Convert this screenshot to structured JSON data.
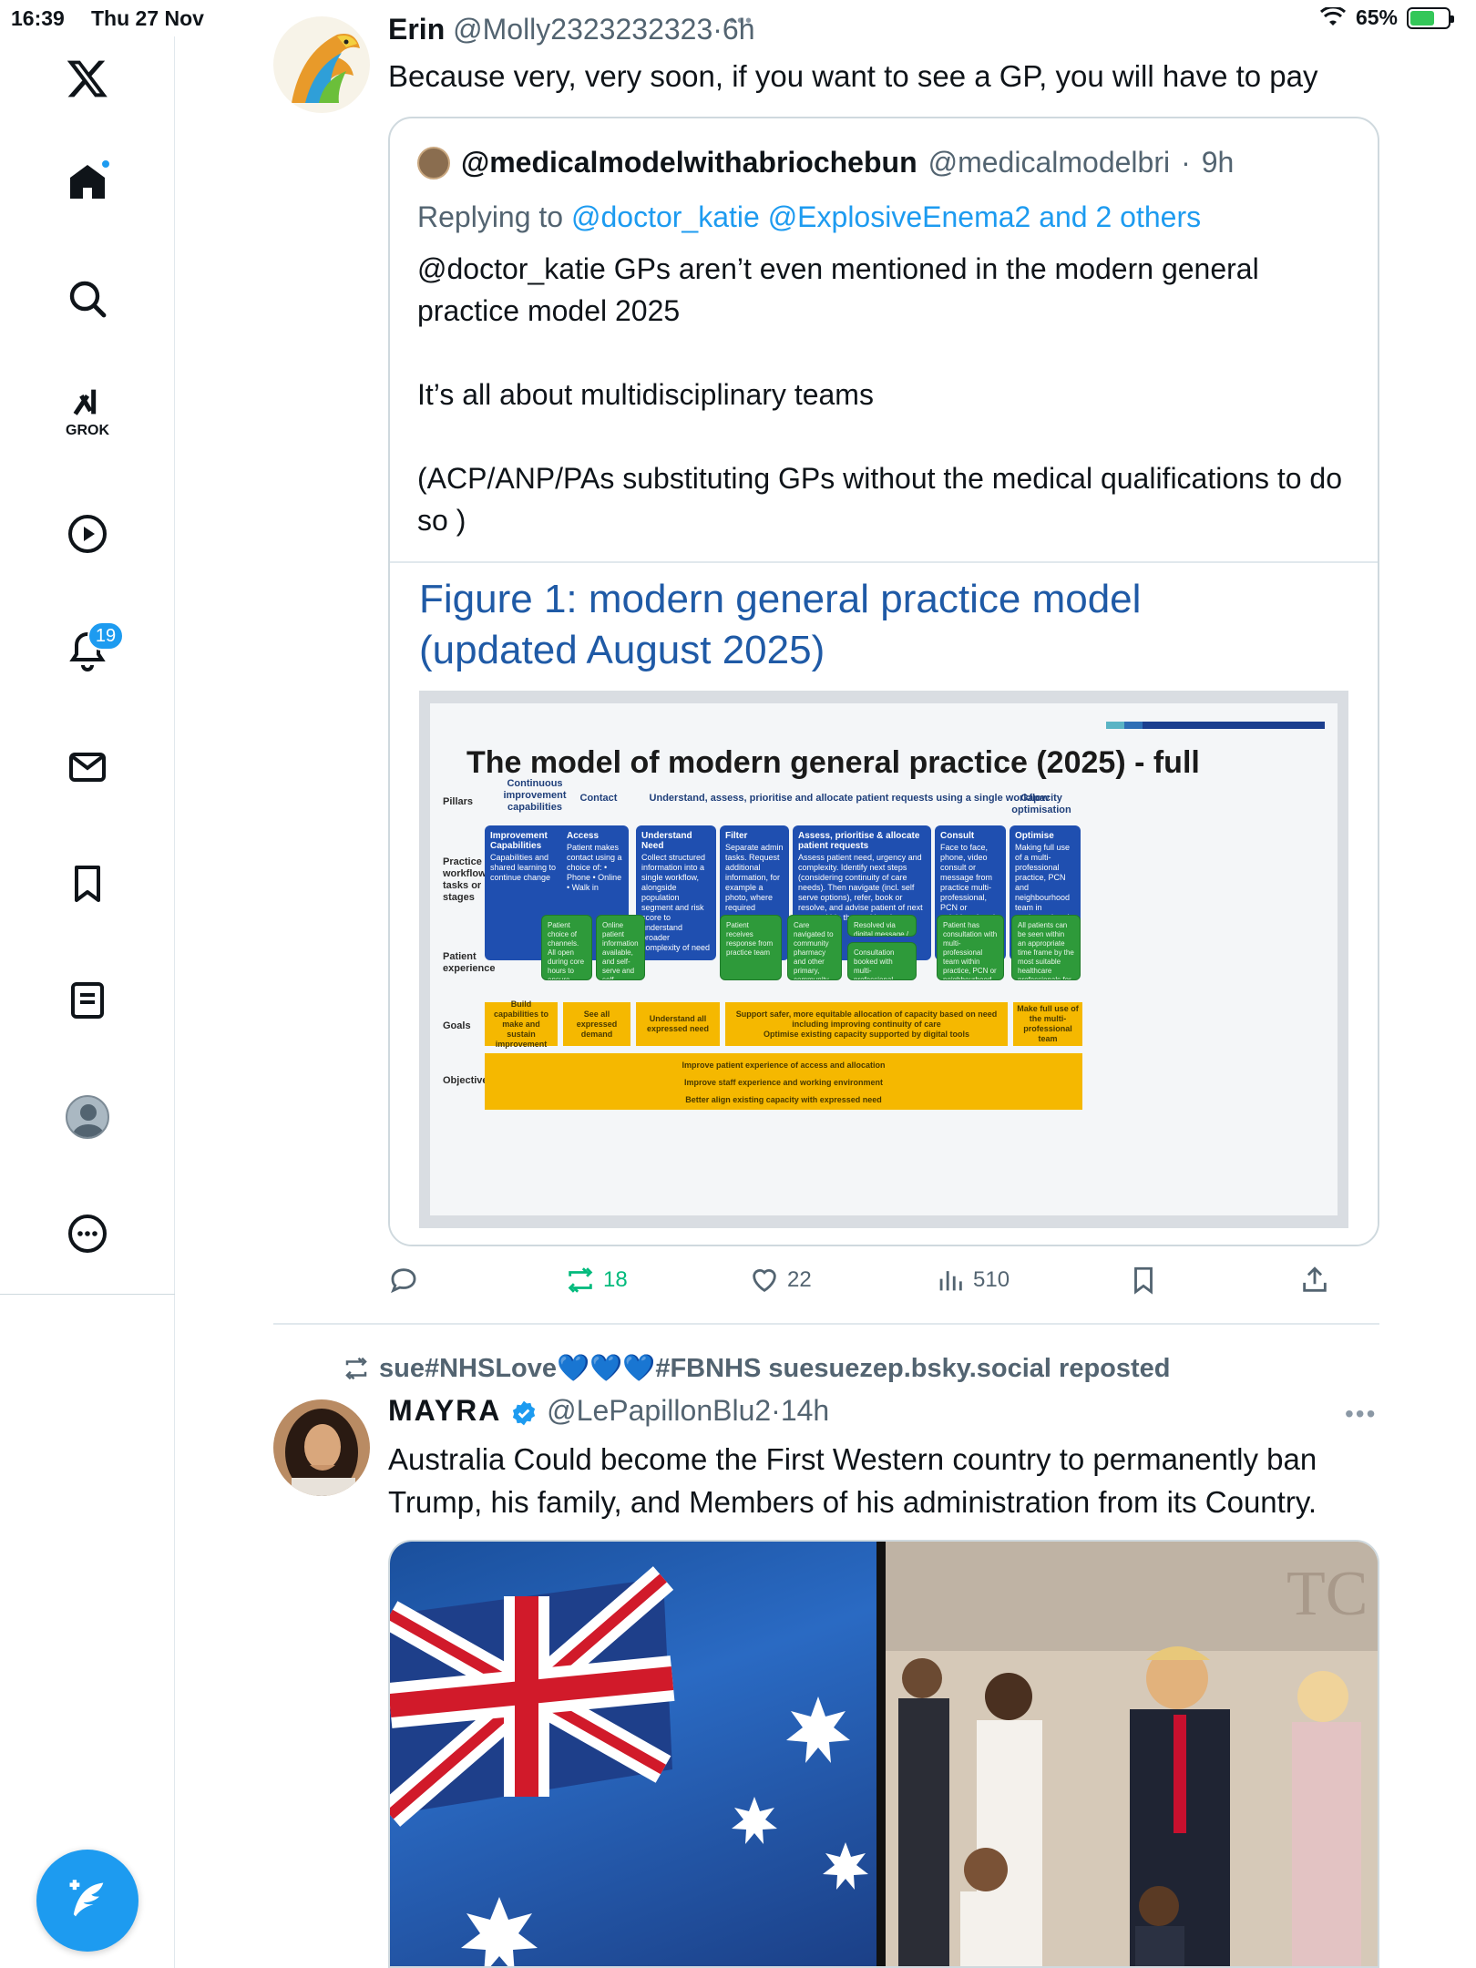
{
  "status_bar": {
    "time": "16:39",
    "date": "Thu 27 Nov",
    "battery": "65%",
    "battery_level": 0.65
  },
  "sidebar": {
    "grok_label": "GROK",
    "notifications_count": "19",
    "items": [
      "home",
      "explore",
      "grok",
      "video",
      "notifications",
      "messages",
      "bookmarks",
      "lists",
      "profile",
      "more"
    ]
  },
  "tweet1": {
    "name": "Erin",
    "handle": "@Molly2323232323",
    "time": "6h",
    "text": "Because very, very soon,  if you want to see a GP, you will have to pay",
    "quote": {
      "name": "@medicalmodelwithabriochebun",
      "handle": "@medicalmodelbri",
      "time": "9h",
      "replying_prefix": "Replying to",
      "replying_to": "@doctor_katie @ExplosiveEnema2 and 2 others",
      "body": "@doctor_katie GPs aren’t even mentioned in the modern general practice model 2025\n\nIt’s all about multidisciplinary teams\n\n(ACP/ANP/PAs substituting GPs without the medical qualifications to do so )",
      "figure": {
        "title": "Figure 1: modern general practice model\n(updated August 2025)",
        "main_title": "The model of modern general practice (2025) - full",
        "row_labels": {
          "pillars": "Pillars",
          "workflow": "Practice workflow tasks or stages",
          "experience": "Patient experience",
          "goals": "Goals",
          "objectives": "Objectives"
        },
        "col_headers": {
          "ci": "Continuous improvement capabilities",
          "contact": "Contact",
          "understand": "Understand, assess, prioritise and allocate patient requests using a single workflow",
          "capacity": "Capacity optimisation"
        },
        "blue_boxes": [
          {
            "title": "Improvement Capabilities",
            "text": "Capabilities and shared learning to continue change"
          },
          {
            "title": "Access",
            "text": "Patient makes contact using a choice of: • Phone • Online • Walk in"
          },
          {
            "title": "Understand Need",
            "text": "Collect structured information into a single workflow, alongside population segment and risk score to understand broader complexity of need"
          },
          {
            "title": "Filter",
            "text": "Separate admin tasks. Request additional information, for example a photo, where required"
          },
          {
            "title": "Assess, prioritise & allocate patient requests",
            "text": "Assess patient need, urgency and complexity. Identify next steps (considering continuity of care needs). Then navigate (incl. self serve options), refer, book or resolve, and advise patient of next steps within the working day."
          },
          {
            "title": "Consult",
            "text": "Face to face, phone, video consult or message from practice multi-professional, PCN or neighbourhood team"
          },
          {
            "title": "Optimise",
            "text": "Making full use of a multi-professional practice, PCN and neighbourhood team in unplanned and planned care"
          }
        ],
        "green_boxes": [
          "Patient choice of channels. All open during core hours to ensure parity",
          "Online patient information available, and self-serve and self-referral",
          "Patient receives response from practice team",
          "Care navigated to community pharmacy and other primary, community and VCSE services",
          "Resolved via digital message / phone",
          "Consultation booked with multi-professional team using self booking link where appropriate",
          "Patient has consultation with multi-professional team within practice, PCN or neighbourhood team",
          "All patients can be seen within an appropriate time frame by the most suitable healthcare professionals for their needs"
        ],
        "goals": [
          "Build capabilities to make and sustain improvement",
          "See all expressed demand",
          "Understand all expressed need",
          "Support safer, more equitable allocation of capacity based on need including improving continuity of care\nOptimise existing capacity supported by digital tools",
          "Make full use of the multi-professional team"
        ],
        "objectives": [
          "Improve patient experience of access and allocation",
          "Improve staff experience and working environment",
          "Better align existing capacity with expressed need"
        ]
      }
    },
    "actions": {
      "reposts": "18",
      "likes": "22",
      "views": "510"
    }
  },
  "repost_banner": "sue#NHSLove💙💙💙#FBNHS suesuezep.bsky.social reposted",
  "tweet2": {
    "name": "MAYRA",
    "handle": "@LePapillonBlu2",
    "time": "14h",
    "text": "Australia Could become the First Western country to permanently ban Trump, his family, and Members of his administration from its Country."
  },
  "colors": {
    "accent": "#1d9bf0",
    "repost_green": "#00ba7c",
    "text_secondary": "#536471",
    "figure_blue": "#1f4fb0",
    "figure_green": "#2e9a3a",
    "figure_yellow": "#f5b800"
  }
}
